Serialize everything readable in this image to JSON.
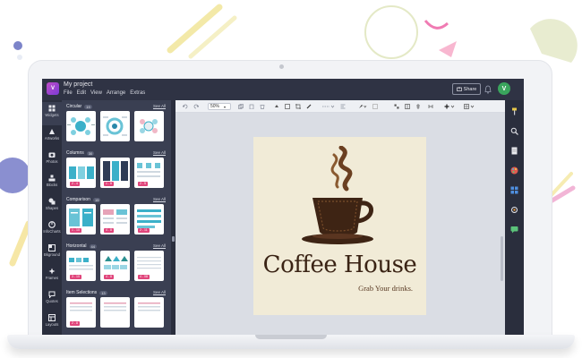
{
  "app": {
    "logo_text": "V",
    "project_title": "My project",
    "menu": [
      "File",
      "Edit",
      "View",
      "Arrange",
      "Extras"
    ],
    "share_label": "Share",
    "avatar_initial": "V"
  },
  "left_rail": [
    {
      "label": "Widgets",
      "icon": "widgets-icon"
    },
    {
      "label": "Artworks",
      "icon": "artworks-icon"
    },
    {
      "label": "Photos",
      "icon": "photos-icon"
    },
    {
      "label": "Blocks",
      "icon": "blocks-icon"
    },
    {
      "label": "Shapes",
      "icon": "shapes-icon"
    },
    {
      "label": "InfoCharts",
      "icon": "infocharts-icon"
    },
    {
      "label": "Bkground",
      "icon": "background-icon"
    },
    {
      "label": "Frames",
      "icon": "frames-icon"
    },
    {
      "label": "Quotes",
      "icon": "quotes-icon"
    },
    {
      "label": "Layouts",
      "icon": "layouts-icon"
    }
  ],
  "panel": {
    "sections": [
      {
        "title": "Circular",
        "count": "19",
        "see_all": "See All",
        "badges": [
          "",
          "",
          ""
        ]
      },
      {
        "title": "Columns",
        "count": "30",
        "see_all": "See All",
        "badges": [
          "2 - 4",
          "1 - 8",
          "2 - 5"
        ]
      },
      {
        "title": "Comparison",
        "count": "15",
        "see_all": "See All",
        "badges": [
          "1 - 10",
          "4 - 8",
          "2 - 11"
        ]
      },
      {
        "title": "Horizontal",
        "count": "44",
        "see_all": "See All",
        "badges": [
          "3 - 10",
          "4 - 8",
          "4 - 08"
        ]
      },
      {
        "title": "Item Selections",
        "count": "13",
        "see_all": "See All",
        "badges": [
          "2 - 8",
          "",
          ""
        ]
      }
    ]
  },
  "toolbar": {
    "zoom": "50%"
  },
  "canvas": {
    "brand_name": "Coffee House",
    "tagline": "Grab Your drinks."
  },
  "colors": {
    "accent": "#e0457b",
    "screen_bg": "#2a2e3d",
    "panel_bg": "#3a3f52",
    "canvas_bg": "#dadde4",
    "artboard_bg": "#f1ebd7",
    "coffee_brown": "#3a2314",
    "avatar_green": "#3aa55d"
  }
}
